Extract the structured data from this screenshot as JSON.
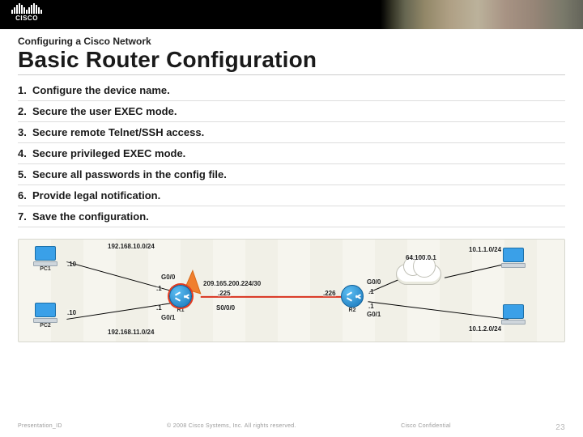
{
  "brand": "CISCO",
  "kicker": "Configuring a Cisco Network",
  "title": "Basic Router Configuration",
  "steps": [
    "Configure the device name.",
    "Secure the user EXEC mode.",
    "Secure remote Telnet/SSH access.",
    "Secure privileged EXEC mode.",
    "Secure all passwords in the config file.",
    "Provide legal notification.",
    "Save the configuration."
  ],
  "diagram": {
    "pc1": "PC1",
    "pc1_addr": ".10",
    "pc2": "PC2",
    "pc2_addr": ".10",
    "r1": "R1",
    "r1_g00": "G0/0",
    "r1_g00_ip": ".1",
    "r1_g01": "G0/1",
    "r1_g01_ip": ".1",
    "r1_s000": "S0/0/0",
    "r1_s000_ip": ".225",
    "r2": "R2",
    "r2_g00": "G0/0",
    "r2_g00_ip": ".1",
    "r2_g01": "G0/1",
    "r2_g01_ip": ".1",
    "r2_s_ip": ".226",
    "cloud_addr": "64.100.0.1",
    "net_top_left": "192.168.10.0/24",
    "net_bottom_left": "192.168.11.0/24",
    "net_wan": "209.165.200.224/30",
    "net_right1": "10.1.1.0/24",
    "net_right2": "10.1.2.0/24"
  },
  "footer": {
    "left": "Presentation_ID",
    "center": "© 2008 Cisco Systems, Inc. All rights reserved.",
    "right": "Cisco Confidential",
    "page": "23"
  }
}
